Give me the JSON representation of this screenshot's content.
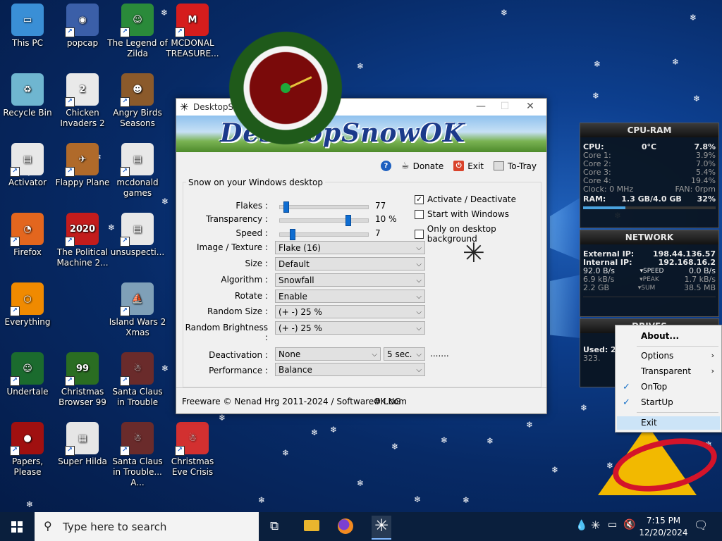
{
  "desktop": {
    "icons": [
      {
        "label": "This PC",
        "color": "#3a8fd6",
        "glyph": "▭"
      },
      {
        "label": "popcap",
        "color": "#3b5fa8",
        "glyph": "◉"
      },
      {
        "label": "The Legend of Zilda",
        "color": "#2a8a3a",
        "glyph": "☺"
      },
      {
        "label": "MCDONAL TREASURE...",
        "color": "#d51d1d",
        "glyph": "M"
      },
      {
        "label": "Recycle Bin",
        "color": "#6fb6d0",
        "glyph": "♻"
      },
      {
        "label": "Chicken Invaders 2",
        "color": "#e9e9e9",
        "glyph": "2"
      },
      {
        "label": "Angry Birds Seasons",
        "color": "#8b5a2b",
        "glyph": "☻"
      },
      {
        "label": "Activator",
        "color": "#e8e8e8",
        "glyph": "▤"
      },
      {
        "label": "Flappy Plane",
        "color": "#b06a2a",
        "glyph": "✈"
      },
      {
        "label": "mcdonald games",
        "color": "#e8e8e8",
        "glyph": "▤"
      },
      {
        "label": "Firefox",
        "color": "#e3661e",
        "glyph": "◔"
      },
      {
        "label": "The Political Machine 2...",
        "color": "#c31c1c",
        "glyph": "2020"
      },
      {
        "label": "unsuspecti...",
        "color": "#e8e8e8",
        "glyph": "▤"
      },
      {
        "label": "Everything",
        "color": "#f08a00",
        "glyph": "○"
      },
      {
        "label": "Island Wars 2 Xmas",
        "color": "#7fa0b8",
        "glyph": "⛵"
      },
      {
        "label": "Undertale",
        "color": "#1b6b2e",
        "glyph": "☺"
      },
      {
        "label": "Christmas Browser 99",
        "color": "#2a6d22",
        "glyph": "99"
      },
      {
        "label": "Santa Claus in Trouble",
        "color": "#6a2b2b",
        "glyph": "☃"
      },
      {
        "label": "Papers, Please",
        "color": "#a01010",
        "glyph": "●"
      },
      {
        "label": "Super Hilda",
        "color": "#e6e6e6",
        "glyph": "▦"
      },
      {
        "label": "Santa Claus in Trouble... A...",
        "color": "#6a2b2b",
        "glyph": "☃"
      },
      {
        "label": "Christmas Eve Crisis",
        "color": "#d23030",
        "glyph": "☃"
      }
    ]
  },
  "window": {
    "title": "DesktopSnowOK",
    "banner_logo": "DesktopSnowOK",
    "toolbar": {
      "help": "?",
      "donate": "Donate",
      "exit": "Exit",
      "totray": "To-Tray"
    },
    "group_label": "Snow on your Windows desktop",
    "sliders": [
      {
        "label": "Flakes :",
        "value": "77",
        "fraction": 0.04
      },
      {
        "label": "Transparency :",
        "value": "10 %",
        "fraction": 0.78
      },
      {
        "label": "Speed :",
        "value": "7",
        "fraction": 0.12
      }
    ],
    "checkboxes": [
      {
        "label": "Activate / Deactivate",
        "checked": true
      },
      {
        "label": "Start with Windows",
        "checked": false
      },
      {
        "label": "Only on desktop background",
        "checked": false
      }
    ],
    "selects": [
      {
        "label": "Image / Texture :",
        "value": "Flake (16)"
      },
      {
        "label": "Size :",
        "value": "Default"
      },
      {
        "label": "Algorithm :",
        "value": "Snowfall"
      },
      {
        "label": "Rotate :",
        "value": "Enable"
      },
      {
        "label": "Random Size :",
        "value": "(+ -) 25 %"
      },
      {
        "label": "Random Brightness :",
        "value": "(+ -) 25 %"
      }
    ],
    "deactivation": {
      "label": "Deactivation :",
      "value": "None",
      "seconds": "5 sec.",
      "dots": "......."
    },
    "performance": {
      "label": "Performance :",
      "value": "Balance"
    },
    "footer": {
      "copyright": "Freeware © Nenad Hrg 2011-2024 / SoftwareOK.com",
      "lng": "# LNG"
    }
  },
  "gadgets": {
    "cpu": {
      "title": "CPU-RAM",
      "cpu_label": "CPU:",
      "temp": "0°C",
      "cpu_value": "7.8%",
      "cores": [
        {
          "label": "Core 1:",
          "value": "3.9%"
        },
        {
          "label": "Core 2:",
          "value": "7.0%"
        },
        {
          "label": "Core 3:",
          "value": "5.4%"
        },
        {
          "label": "Core 4:",
          "value": "19.4%"
        }
      ],
      "clock": "Clock: 0 MHz",
      "fan": "FAN: 0rpm",
      "ram_label": "RAM:",
      "ram_value": "1.3 GB/4.0 GB",
      "ram_pct": "32%"
    },
    "network": {
      "title": "NETWORK",
      "ext_label": "External IP:",
      "ext_ip": "198.44.136.57",
      "int_label": "Internal IP:",
      "int_ip": "192.168.16.2",
      "rows": [
        {
          "left": "92.0 B/s",
          "mid": "SPEED",
          "right": "0.0 B/s"
        },
        {
          "left": "6.9 kB/s",
          "mid": "PEAK",
          "right": "1.7 kB/s"
        },
        {
          "left": "2.2 GB",
          "mid": "SUM",
          "right": "38.5 MB"
        }
      ]
    },
    "drives": {
      "title": "DRIVES",
      "used": "Used: 28.",
      "free": "323."
    }
  },
  "context_menu": {
    "items": [
      {
        "label": "About...",
        "bold": true
      },
      {
        "label": "Options",
        "submenu": true
      },
      {
        "label": "Transparent",
        "submenu": true
      },
      {
        "label": "OnTop",
        "checked": true
      },
      {
        "label": "StartUp",
        "checked": true
      },
      {
        "label": "Exit",
        "highlighted": true
      }
    ]
  },
  "taskbar": {
    "search_placeholder": "Type here to search",
    "time": "7:15 PM",
    "date": "12/20/2024"
  },
  "colors": {
    "accent": "#0f6dd1",
    "taskbar": "#0a1f3d",
    "menu_highlight": "#cce4f7"
  }
}
